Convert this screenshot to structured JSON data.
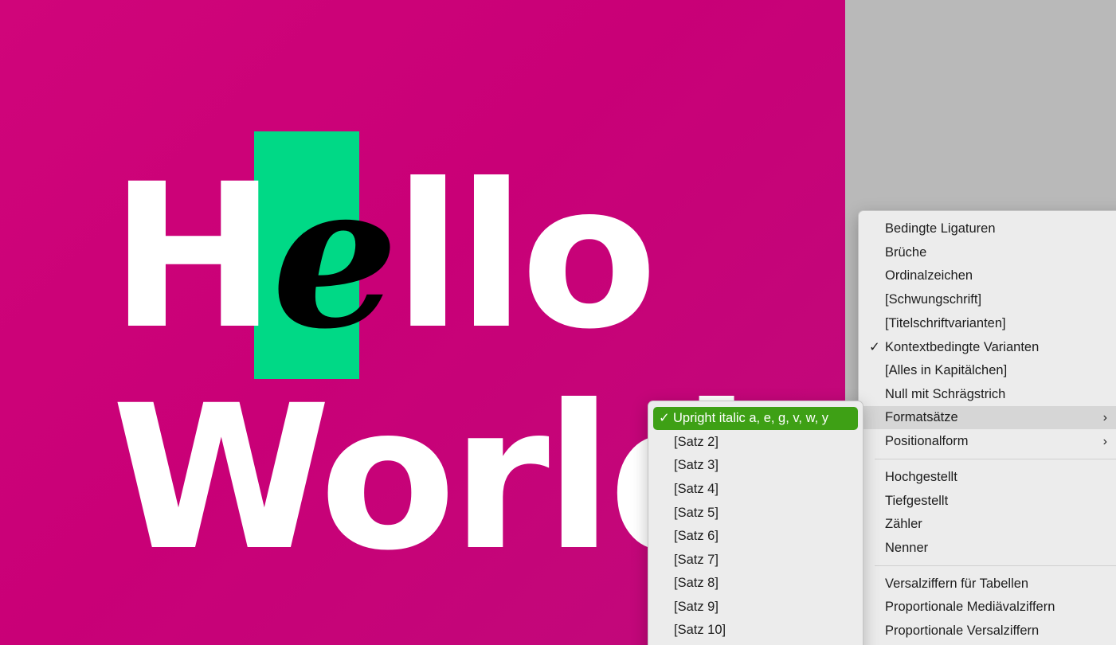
{
  "canvas": {
    "hello": [
      "H",
      "e",
      "llo"
    ],
    "world": "World"
  },
  "menu": {
    "items": [
      {
        "label": "Bedingte Ligaturen"
      },
      {
        "label": "Brüche"
      },
      {
        "label": "Ordinalzeichen"
      },
      {
        "label": "[Schwungschrift]"
      },
      {
        "label": "[Titelschriftvarianten]"
      },
      {
        "label": "Kontextbedingte Varianten",
        "checked": true
      },
      {
        "label": "[Alles in Kapitälchen]"
      },
      {
        "label": "Null mit Schrägstrich"
      },
      {
        "label": "Formatsätze",
        "submenu": true,
        "active": true
      },
      {
        "label": "Positionalform",
        "submenu": true
      },
      {
        "label": "Hochgestellt"
      },
      {
        "label": "Tiefgestellt"
      },
      {
        "label": "Zähler"
      },
      {
        "label": "Nenner"
      },
      {
        "label": "Versalziffern für Tabellen"
      },
      {
        "label": "Proportionale Mediävalziffern"
      },
      {
        "label": "Proportionale Versalziffern"
      }
    ],
    "chevron": "›"
  },
  "submenu": {
    "items": [
      {
        "label": "Upright italic a, e, g, v, w, y",
        "selected": true
      },
      {
        "label": "[Satz 2]"
      },
      {
        "label": "[Satz 3]"
      },
      {
        "label": "[Satz 4]"
      },
      {
        "label": "[Satz 5]"
      },
      {
        "label": "[Satz 6]"
      },
      {
        "label": "[Satz 7]"
      },
      {
        "label": "[Satz 8]"
      },
      {
        "label": "[Satz 9]"
      },
      {
        "label": "[Satz 10]"
      }
    ]
  },
  "colors": {
    "canvas_magenta": "#cc0077",
    "highlight_green": "#00d986",
    "selection_green": "#3ea015",
    "menu_bg": "#ececec"
  }
}
